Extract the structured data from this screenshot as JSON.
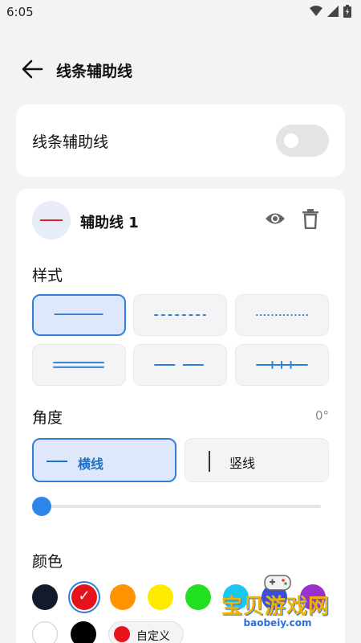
{
  "status_bar": {
    "time": "6:05"
  },
  "app_bar": {
    "title": "线条辅助线"
  },
  "toggle_card": {
    "label": "线条辅助线",
    "enabled": false
  },
  "guide": {
    "title": "辅助线 1",
    "line_color": "#d8262b",
    "icons": [
      "eye-icon",
      "trash-icon"
    ]
  },
  "style_section": {
    "label": "样式",
    "options": [
      {
        "name": "solid",
        "selected": true
      },
      {
        "name": "dashed",
        "selected": false
      },
      {
        "name": "dotted",
        "selected": false
      },
      {
        "name": "double",
        "selected": false
      },
      {
        "name": "long-dash",
        "selected": false
      },
      {
        "name": "tick-marks",
        "selected": false
      }
    ]
  },
  "angle_section": {
    "label": "角度",
    "value": "0°",
    "orientations": [
      {
        "label": "横线",
        "selected": true
      },
      {
        "label": "竖线",
        "selected": false
      }
    ],
    "slider_fraction": 0
  },
  "color_section": {
    "label": "颜色",
    "swatches": [
      {
        "color": "#141a2b",
        "selected": false
      },
      {
        "color": "#e5131b",
        "selected": true,
        "check": "✓"
      },
      {
        "color": "#ff9300",
        "selected": false
      },
      {
        "color": "#ffeb00",
        "selected": false
      },
      {
        "color": "#20e020",
        "selected": false
      },
      {
        "color": "#19c7ef",
        "selected": false
      },
      {
        "color": "#3b4ed8",
        "selected": false
      },
      {
        "color": "#9b2fd0",
        "selected": false
      },
      {
        "color": "#ffffff",
        "selected": false
      },
      {
        "color": "#000000",
        "selected": false
      }
    ],
    "custom_label": "自定义",
    "custom_color": "#e5131b"
  },
  "watermark": {
    "brand": "宝贝游戏网",
    "url": "baobeiy.com"
  },
  "accent_color": "#2f80d8"
}
